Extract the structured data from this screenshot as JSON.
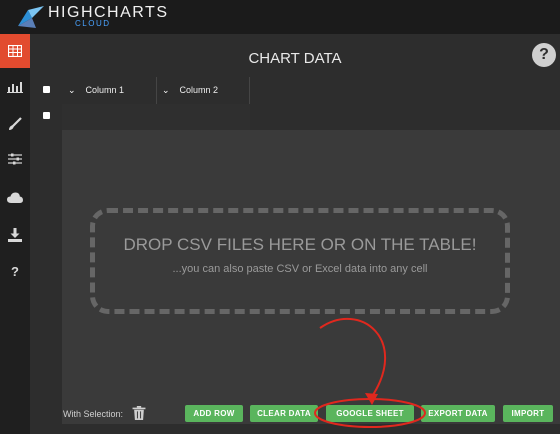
{
  "app": {
    "logo_text": "HIGHCHARTS",
    "logo_sub": "CLOUD"
  },
  "sidebar": {
    "items": [
      {
        "icon": "table-icon"
      },
      {
        "icon": "bar-chart-icon"
      },
      {
        "icon": "brush-icon"
      },
      {
        "icon": "sliders-icon"
      },
      {
        "icon": "cloud-icon"
      },
      {
        "icon": "download-icon"
      },
      {
        "icon": "help-icon",
        "glyph": "?"
      }
    ]
  },
  "main": {
    "title": "CHART DATA",
    "help": "?",
    "columns": [
      "Column 1",
      "Column 2"
    ],
    "drop_title": "DROP CSV FILES HERE OR ON THE TABLE!",
    "drop_sub": "...you can also paste CSV or Excel data into any cell",
    "selection_label": "With Selection:"
  },
  "buttons": {
    "add_row": "ADD ROW",
    "clear_data": "CLEAR DATA",
    "google_sheet": "GOOGLE SHEET",
    "export_data": "EXPORT DATA",
    "import": "IMPORT"
  },
  "colors": {
    "accent": "#e24b2f",
    "button": "#5ab55d",
    "annotation": "#e0281e"
  }
}
